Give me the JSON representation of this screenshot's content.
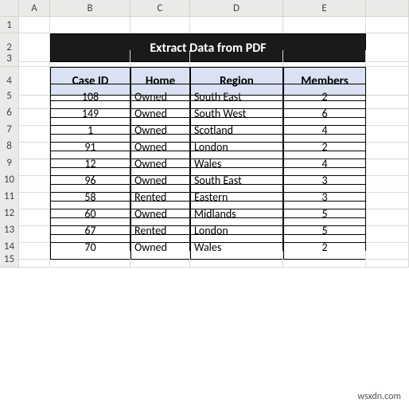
{
  "columns": [
    "A",
    "B",
    "C",
    "D",
    "E"
  ],
  "row_labels": [
    "1",
    "2",
    "3",
    "4",
    "5",
    "6",
    "7",
    "8",
    "9",
    "10",
    "11",
    "12",
    "13",
    "14",
    "15"
  ],
  "title": "Extract Data from PDF",
  "headers": {
    "case_id": "Case ID",
    "home": "Home",
    "region": "Region",
    "members": "Members"
  },
  "chart_data": {
    "type": "table",
    "columns": [
      "Case ID",
      "Home",
      "Region",
      "Members"
    ],
    "rows": [
      {
        "case_id": 108,
        "home": "Owned",
        "region": "South East",
        "members": 2
      },
      {
        "case_id": 149,
        "home": "Owned",
        "region": "South West",
        "members": 6
      },
      {
        "case_id": 1,
        "home": "Owned",
        "region": "Scotland",
        "members": 4
      },
      {
        "case_id": 91,
        "home": "Owned",
        "region": "London",
        "members": 2
      },
      {
        "case_id": 12,
        "home": "Owned",
        "region": "Wales",
        "members": 4
      },
      {
        "case_id": 96,
        "home": "Owned",
        "region": "South East",
        "members": 3
      },
      {
        "case_id": 58,
        "home": "Rented",
        "region": "Eastern",
        "members": 3
      },
      {
        "case_id": 60,
        "home": "Owned",
        "region": "Midlands",
        "members": 5
      },
      {
        "case_id": 67,
        "home": "Rented",
        "region": "London",
        "members": 5
      },
      {
        "case_id": 70,
        "home": "Owned",
        "region": "Wales",
        "members": 2
      }
    ]
  },
  "watermark": "wsxdn.com"
}
